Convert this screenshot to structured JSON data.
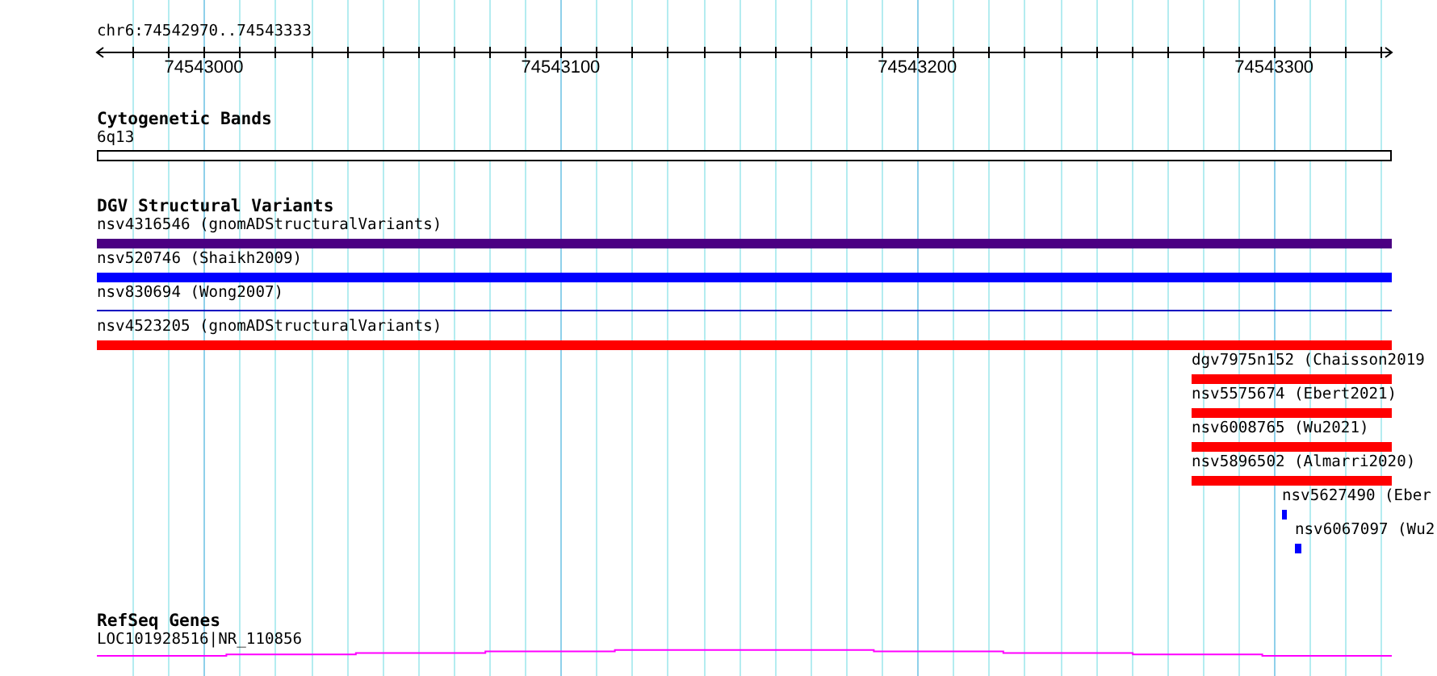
{
  "region": {
    "label": "chr6:74542970..74543333"
  },
  "ruler": {
    "ticks": [
      {
        "label": "74543000"
      },
      {
        "label": "74543100"
      },
      {
        "label": "74543200"
      },
      {
        "label": "74543300"
      }
    ]
  },
  "tracks": [
    {
      "title": "Cytogenetic Bands",
      "features": [
        {
          "kind": "band",
          "label": "6q13"
        }
      ]
    },
    {
      "title": "DGV Structural Variants",
      "features": [
        {
          "kind": "bar",
          "label": "nsv4316546 (gnomADStructuralVariants)",
          "color": "#4b0082"
        },
        {
          "kind": "bar",
          "label": "nsv520746 (Shaikh2009)",
          "color": "#0000ff"
        },
        {
          "kind": "line",
          "label": "nsv830694 (Wong2007)",
          "color": "#0000c0"
        },
        {
          "kind": "bar",
          "label": "nsv4523205 (gnomADStructuralVariants)",
          "color": "#ff0000"
        },
        {
          "kind": "bar",
          "label": "dgv7975n152 (Chaisson2019",
          "color": "#ff0000"
        },
        {
          "kind": "bar",
          "label": "nsv5575674 (Ebert2021)",
          "color": "#ff0000"
        },
        {
          "kind": "bar",
          "label": "nsv6008765 (Wu2021)",
          "color": "#ff0000"
        },
        {
          "kind": "bar",
          "label": "nsv5896502 (Almarri2020)",
          "color": "#ff0000"
        },
        {
          "kind": "bar",
          "label": "nsv5627490 (Eber",
          "color": "#0000ff"
        },
        {
          "kind": "bar",
          "label": "nsv6067097 (Wu2",
          "color": "#0000ff"
        }
      ]
    },
    {
      "title": "RefSeq Genes",
      "features": [
        {
          "kind": "gene",
          "label": "LOC101928516|NR_110856",
          "color": "#ff00ff"
        }
      ]
    }
  ]
}
